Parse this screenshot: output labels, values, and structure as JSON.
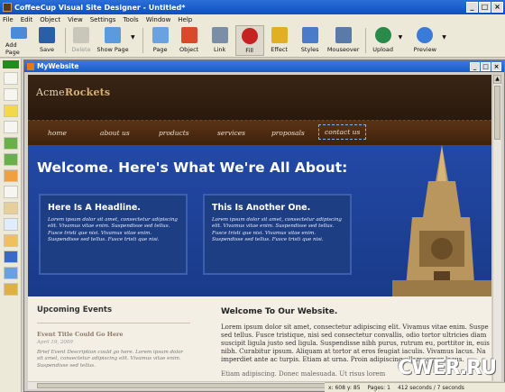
{
  "app": {
    "title": "CoffeeCup Visual Site Designer - Untitled*"
  },
  "menu": [
    "File",
    "Edit",
    "Object",
    "View",
    "Settings",
    "Tools",
    "Window",
    "Help"
  ],
  "toolbar": [
    {
      "label": "Add Page",
      "icon": "add-page-icon",
      "color": "#4a8ad8"
    },
    {
      "label": "Save",
      "icon": "save-icon",
      "color": "#2a5fa8"
    },
    {
      "label": "Delete",
      "icon": "delete-icon",
      "color": "#c9c6ba"
    },
    {
      "label": "Show Page",
      "icon": "show-page-icon",
      "color": "#5a9adf"
    },
    {
      "label": "Page",
      "icon": "page-icon",
      "color": "#6aa2e0"
    },
    {
      "label": "Object",
      "icon": "object-icon",
      "color": "#d94a2a"
    },
    {
      "label": "Link",
      "icon": "link-icon",
      "color": "#7a8ea8"
    },
    {
      "label": "Fill",
      "icon": "fill-icon",
      "color": "#c62222"
    },
    {
      "label": "Effect",
      "icon": "effect-icon",
      "color": "#e0b020"
    },
    {
      "label": "Styles",
      "icon": "styles-icon",
      "color": "#4a7ac8"
    },
    {
      "label": "Mouseover",
      "icon": "mouseover-icon",
      "color": "#5a7aa8"
    },
    {
      "label": "Upload",
      "icon": "upload-icon",
      "color": "#2a8a4a"
    },
    {
      "label": "Preview",
      "icon": "preview-icon",
      "color": "#3a7ad8"
    }
  ],
  "document": {
    "title": "MyWebsite"
  },
  "site": {
    "logo_a": "Acme",
    "logo_b": "Rockets",
    "nav": [
      "home",
      "about us",
      "products",
      "services",
      "proposals",
      "contact us"
    ],
    "hero_title": "Welcome. Here's What We're All About:",
    "boxes": [
      {
        "title": "Here Is A Headline.",
        "text": "Lorem ipsum dolor sit amet, consectetur adipiscing elit. Vivamus vitae enim. Suspendisse sed tellus. Fusce tristi que nisi. Vivamus vitae enim. Suspendisse sed tellus. Fusce tristi que nisi."
      },
      {
        "title": "This Is Another One.",
        "text": "Lorem ipsum dolor sit amet, consectetur adipiscing elit. Vivamus vitae enim. Suspendisse sed tellus. Fusce tristi que nisi. Vivamus vitae enim. Suspendisse sed tellus. Fusce tristi que nisi."
      }
    ],
    "events_heading": "Upcoming Events",
    "event_title": "Event Title Could Go Here",
    "event_date": "April 19, 2009",
    "event_desc": "Brief Event Description could go here. Lorem ipsum dolor sit amet, consectetur adipiscing elit. Vivamus vitae enim. Suspendisse sed tellus.",
    "welcome_heading": "Welcome To Our Website.",
    "welcome_lines": [
      "Lorem ipsum dolor sit amet, consectetur adipiscing elit. Vivamus vitae enim. Suspe",
      "sed tellus. Fusce tristique, nisi sed consectetur convallis, odio tortor ultricies diam",
      "suscipit ligula justo sed ligula. Suspendisse nibh purus, rutrum eu, porttitor in, euis",
      "nibh. Curabitur ipsum. Aliquam at tortor at eros feugiat iaculis. Vivamus lacus. Na",
      "imperdiet ante ac turpis. Etiam at urna. Proin adipiscing ullamcorper lacus."
    ],
    "welcome_next": "Etiam adipiscing. Donec malesuada. Ut risus lorem"
  },
  "status": {
    "coords": "x: 608  y: 85",
    "pages": "Pages: 1",
    "time": "412 seconds / 7 seconds"
  },
  "watermark": "CWER.RU"
}
